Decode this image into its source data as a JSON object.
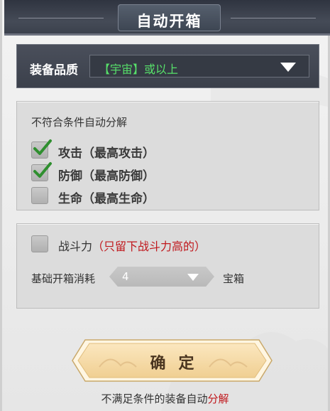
{
  "dialog": {
    "title": "自动开箱"
  },
  "quality": {
    "label": "装备品质",
    "value": "【宇宙】或以上"
  },
  "decompose": {
    "title": "不符合条件自动分解",
    "options": [
      {
        "label": "攻击（最高攻击）",
        "checked": true
      },
      {
        "label": "防御（最高防御）",
        "checked": true
      },
      {
        "label": "生命（最高生命）",
        "checked": false
      }
    ]
  },
  "power": {
    "label": "战斗力",
    "note": "（只留下战斗力高的）",
    "checked": false,
    "cost_label": "基础开箱消耗",
    "cost_value": "4",
    "chest_label": "宝箱"
  },
  "confirm": {
    "label": "确定"
  },
  "footer": {
    "text": "不满足条件的装备自动",
    "highlight": "分解"
  },
  "colors": {
    "accent_green": "#57e06a",
    "warning_red": "#c0181d",
    "header_dark": "#3b404b"
  }
}
